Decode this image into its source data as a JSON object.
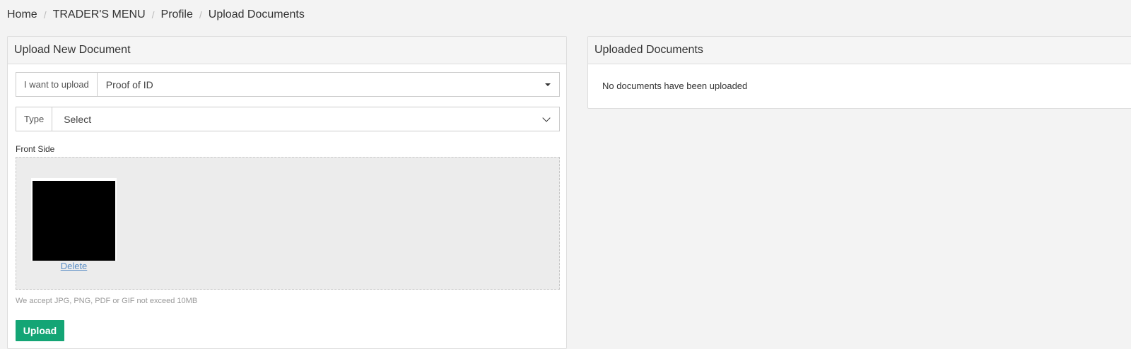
{
  "breadcrumb": {
    "items": [
      "Home",
      "TRADER'S MENU",
      "Profile",
      "Upload Documents"
    ],
    "separator": "/"
  },
  "upload_panel": {
    "title": "Upload New Document",
    "want_label": "I want to upload",
    "want_value": "Proof of ID",
    "type_label": "Type",
    "type_value": "Select",
    "front_label": "Front Side",
    "delete_label": "Delete",
    "hint": "We accept JPG, PNG, PDF or GIF not exceed 10MB",
    "upload_label": "Upload"
  },
  "uploaded_panel": {
    "title": "Uploaded Documents",
    "empty_message": "No documents have been uploaded"
  },
  "colors": {
    "accent_green": "#14a575",
    "link_blue": "#5b8ec5",
    "background": "#f3f3f3"
  }
}
